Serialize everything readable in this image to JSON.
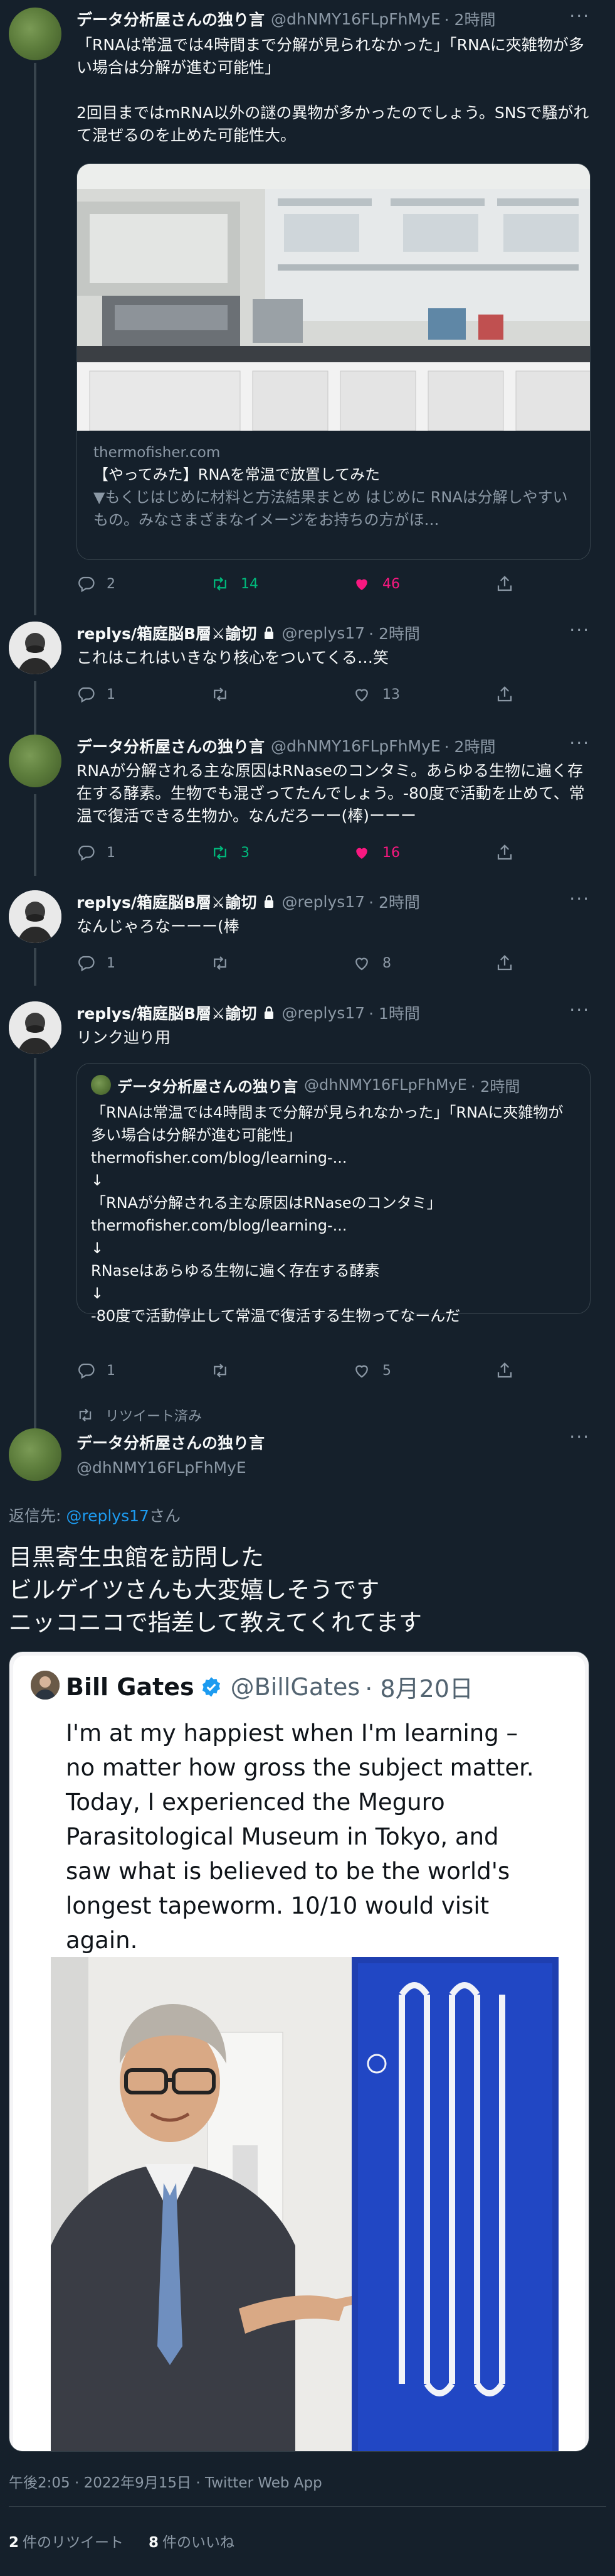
{
  "tweet1": {
    "name": "データ分析屋さんの独り言",
    "handle": "@dhNMY16FLpFhMyE",
    "time": "· 2時間",
    "text": "「RNAは常温では4時間まで分解が見られなかった」「RNAに夾雑物が多い場合は分解が進む可能性」\n\n2回目まではmRNA以外の謎の異物が多かったのでしょう。SNSで騒がれて混ぜるのを止めた可能性大。",
    "card": {
      "domain": "thermofisher.com",
      "title": "【やってみた】RNAを常温で放置してみた",
      "desc": "▼もくじはじめに材料と方法結果まとめ はじめに RNAは分解しやすいもの。みなさまざまなイメージをお持ちの方がほ…"
    },
    "replies": "2",
    "retweets": "14",
    "likes": "46"
  },
  "tweet2": {
    "name": "replys/箱庭脳B層⚔諭切",
    "handle": "@replys17",
    "time": "· 2時間",
    "text": "これはこれはいきなり核心をついてくる…笑",
    "replies": "1",
    "retweets": "",
    "likes": "13"
  },
  "tweet3": {
    "name": "データ分析屋さんの独り言",
    "handle": "@dhNMY16FLpFhMyE",
    "time": "· 2時間",
    "text": "RNAが分解される主な原因はRNaseのコンタミ。あらゆる生物に遍く存在する酵素。生物でも混ざってたんでしょう。-80度で活動を止めて、常温で復活できる生物か。なんだろーー(棒)ーーー",
    "replies": "1",
    "retweets": "3",
    "likes": "16"
  },
  "tweet4": {
    "name": "replys/箱庭脳B層⚔諭切",
    "handle": "@replys17",
    "time": "· 2時間",
    "text": "なんじゃろなーーー(棒",
    "replies": "1",
    "retweets": "",
    "likes": "8"
  },
  "tweet5": {
    "name": "replys/箱庭脳B層⚔諭切",
    "handle": "@replys17",
    "time": "· 1時間",
    "text": "リンク辿り用",
    "quote": {
      "name": "データ分析屋さんの独り言",
      "handle": "@dhNMY16FLpFhMyE",
      "time": "· 2時間",
      "text": "「RNAは常温では4時間まで分解が見られなかった」「RNAに夾雑物が多い場合は分解が進む可能性」\nthermofisher.com/blog/learning-...\n↓\n「RNAが分解される主な原因はRNaseのコンタミ」\nthermofisher.com/blog/learning-...\n↓\nRNaseはあらゆる生物に遍く存在する酵素\n↓\n-80度で活動停止して常温で復活する生物ってなーんだ"
    },
    "replies": "1",
    "retweets": "",
    "likes": "5"
  },
  "main": {
    "retweeted_label": "リツイート済み",
    "name": "データ分析屋さんの独り言",
    "handle": "@dhNMY16FLpFhMyE",
    "reply_prefix": "返信先: ",
    "reply_handle": "@replys17",
    "reply_suffix": "さん",
    "text": "目黒寄生虫館を訪問した\nビルゲイツさんも大変嬉しそうです\nニッコニコで指差して教えてくれてます",
    "screenshot": {
      "name": "Bill Gates",
      "handle": "@BillGates",
      "date": "· 8月20日",
      "text": "I'm at my happiest when I'm learning – no matter how gross the subject matter. Today, I experienced the Meguro Parasitological Museum in Tokyo, and saw what is believed to be the world's longest tapeworm. 10/10 would visit again."
    },
    "timestamp": "午後2:05 · 2022年9月15日 · Twitter Web App",
    "retweet_count": "2",
    "retweet_label": "件のリツイート",
    "like_count": "8",
    "like_label": "件のいいね"
  },
  "colors": {
    "background": "#15202b",
    "accent": "#1d9bf0",
    "retweet": "#00ba7c",
    "like": "#f91880",
    "muted": "#8b98a5"
  }
}
